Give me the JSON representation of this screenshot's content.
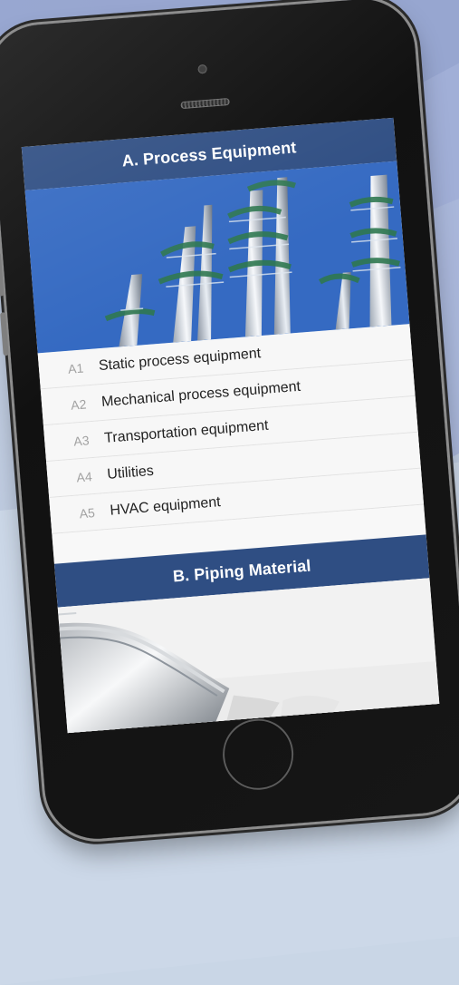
{
  "app": {
    "sections": [
      {
        "title": "A. Process Equipment",
        "items": [
          {
            "code": "A1",
            "label": "Static process equipment"
          },
          {
            "code": "A2",
            "label": "Mechanical process equipment"
          },
          {
            "code": "A3",
            "label": "Transportation equipment"
          },
          {
            "code": "A4",
            "label": "Utilities"
          },
          {
            "code": "A5",
            "label": "HVAC equipment"
          }
        ]
      },
      {
        "title": "B. Piping Material"
      }
    ]
  },
  "images": {
    "process": "refinery-columns-image",
    "piping": "insulated-pipe-image"
  },
  "colors": {
    "header": "#2f4e83",
    "list_bg": "#f7f7f7",
    "code": "#a2a2a2",
    "text": "#222222"
  }
}
